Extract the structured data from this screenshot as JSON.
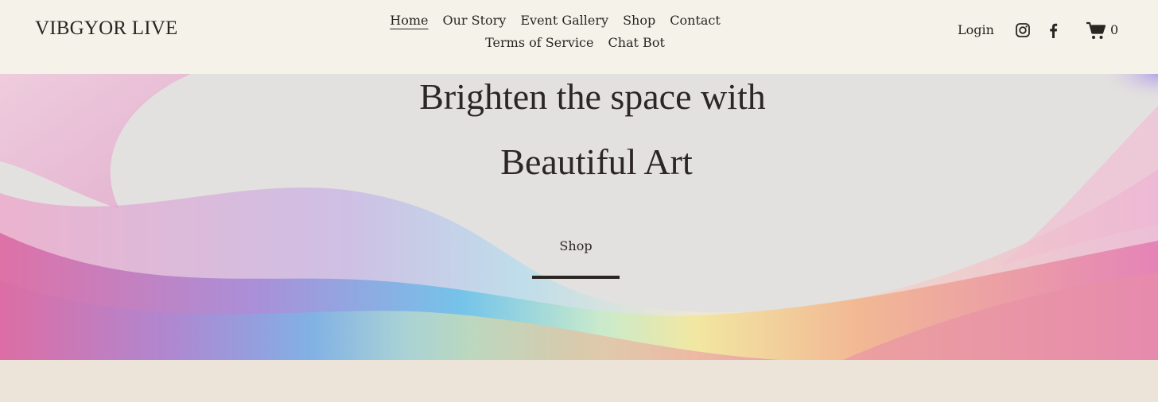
{
  "header": {
    "logo": "VIBGYOR LIVE",
    "nav_row1": [
      "Home",
      "Our Story",
      "Event Gallery",
      "Shop",
      "Contact"
    ],
    "nav_row2": [
      "Terms of Service",
      "Chat Bot"
    ],
    "active_item": "Home",
    "login": "Login",
    "cart_count": "0",
    "icons": [
      "instagram-icon",
      "facebook-icon",
      "cart-icon"
    ]
  },
  "hero": {
    "line1": "Brighten the space with",
    "line2": "Beautiful Art",
    "cta": "Shop"
  },
  "colors": {
    "header_bg": "#f5f2ea",
    "page_bg": "#ede4d9",
    "text": "#2a2522"
  }
}
